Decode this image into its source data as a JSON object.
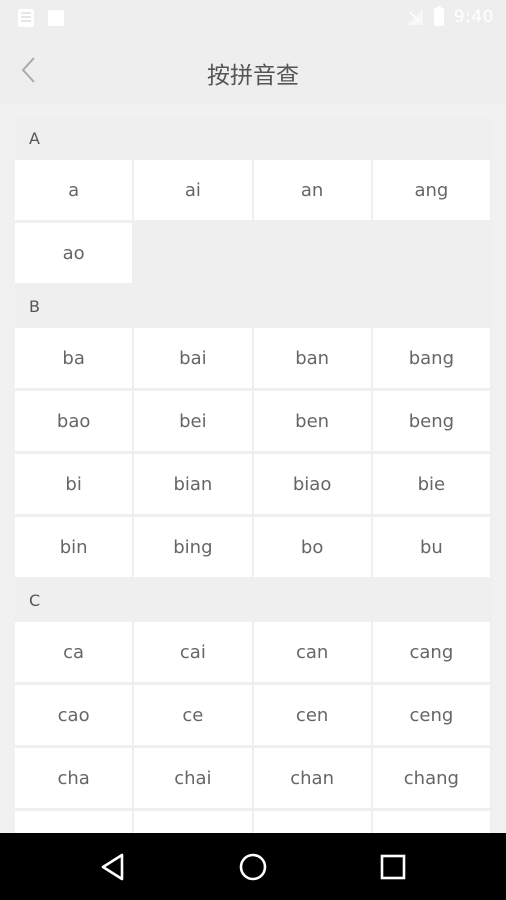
{
  "status_bar": {
    "time": "9:40",
    "icons": [
      "document-notification-icon",
      "image-notification-icon",
      "signal-icon",
      "battery-icon"
    ]
  },
  "header": {
    "title": "按拼音查",
    "back_icon": "chevron-left-icon"
  },
  "sections": [
    {
      "letter": "A",
      "items": [
        "a",
        "ai",
        "an",
        "ang",
        "ao"
      ]
    },
    {
      "letter": "B",
      "items": [
        "ba",
        "bai",
        "ban",
        "bang",
        "bao",
        "bei",
        "ben",
        "beng",
        "bi",
        "bian",
        "biao",
        "bie",
        "bin",
        "bing",
        "bo",
        "bu"
      ]
    },
    {
      "letter": "C",
      "items": [
        "ca",
        "cai",
        "can",
        "cang",
        "cao",
        "ce",
        "cen",
        "ceng",
        "cha",
        "chai",
        "chan",
        "chang",
        "",
        "",
        "",
        ""
      ]
    }
  ],
  "nav": {
    "icons": [
      "back-triangle-icon",
      "home-circle-icon",
      "recents-square-icon"
    ]
  },
  "colors": {
    "background": "#f1f1f1",
    "header": "#eeeeee",
    "cell": "#ffffff",
    "text": "#666666",
    "nav_bar": "#000000"
  }
}
